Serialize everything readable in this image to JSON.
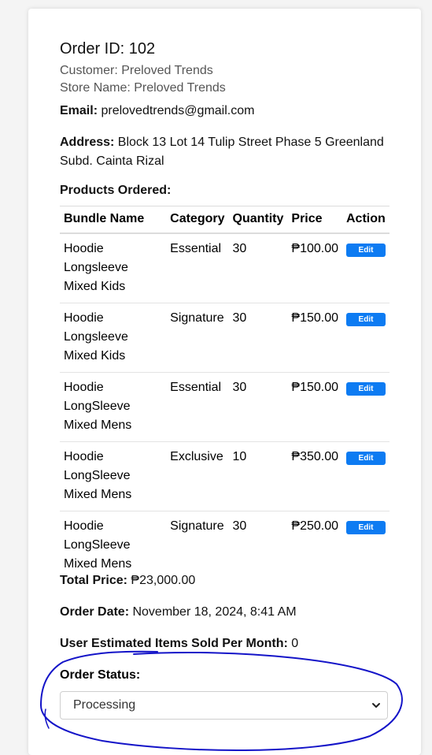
{
  "order": {
    "title": "Order ID: 102",
    "customer": "Customer: Preloved Trends",
    "store": "Store Name: Preloved Trends",
    "email_label": "Email:",
    "email_value": " prelovedtrends@gmail.com",
    "address_label": "Address:",
    "address_value": " Block 13 Lot 14 Tulip Street Phase 5 Greenland Subd. Cainta Rizal",
    "products_label": "Products Ordered:"
  },
  "table": {
    "headers": [
      "Bundle Name",
      "Category",
      "Quantity",
      "Price",
      "Action"
    ],
    "rows": [
      {
        "bundle": "Hoodie Longsleeve Mixed Kids",
        "category": "Essential",
        "quantity": "30",
        "price": "₱100.00",
        "action": "Edit"
      },
      {
        "bundle": "Hoodie Longsleeve Mixed Kids",
        "category": "Signature",
        "quantity": "30",
        "price": "₱150.00",
        "action": "Edit"
      },
      {
        "bundle": "Hoodie LongSleeve Mixed Mens",
        "category": "Essential",
        "quantity": "30",
        "price": "₱150.00",
        "action": "Edit"
      },
      {
        "bundle": "Hoodie LongSleeve Mixed Mens",
        "category": "Exclusive",
        "quantity": "10",
        "price": "₱350.00",
        "action": "Edit"
      },
      {
        "bundle": "Hoodie LongSleeve Mixed Mens",
        "category": "Signature",
        "quantity": "30",
        "price": "₱250.00",
        "action": "Edit"
      }
    ]
  },
  "summary": {
    "total_label": "Total Price:",
    "total_value": " ₱23,000.00",
    "date_label": "Order Date:",
    "date_value": " November 18, 2024, 8:41 AM",
    "sold_label": "User Estimated Items Sold Per Month:",
    "sold_value": " 0"
  },
  "status": {
    "label": "Order Status:",
    "selected": "Processing",
    "icon": "chevron-down-icon"
  },
  "colors": {
    "accent": "#0d7bf2",
    "annotation": "#1010c8"
  }
}
